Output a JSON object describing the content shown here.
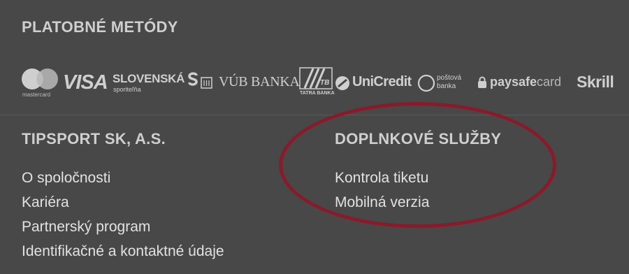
{
  "payment": {
    "title": "PLATOBNÉ METÓDY",
    "logos": {
      "mastercard": "mastercard",
      "visa": "VISA",
      "slovenska": "SLOVENSKÁ",
      "sporitelna": "sporiteľňa",
      "vub": "VÚB BANKA",
      "tatra_mark": "TB",
      "tatra": "TATRA BANKA",
      "unicredit": "UniCredit",
      "postova1": "poštová",
      "postova2": "banka",
      "paysafe_bold": "paysafe",
      "paysafe_light": "card",
      "skrill": "Skrill"
    }
  },
  "company": {
    "title": "TIPSPORT SK, A.S.",
    "links": [
      "O spoločnosti",
      "Kariéra",
      "Partnerský program",
      "Identifikačné a kontaktné údaje"
    ]
  },
  "services": {
    "title": "DOPLNKOVÉ SLUŽBY",
    "links": [
      "Kontrola tiketu",
      "Mobilná verzia"
    ]
  },
  "colors": {
    "background": "#484848",
    "highlight_ellipse": "#8a1a2b"
  }
}
